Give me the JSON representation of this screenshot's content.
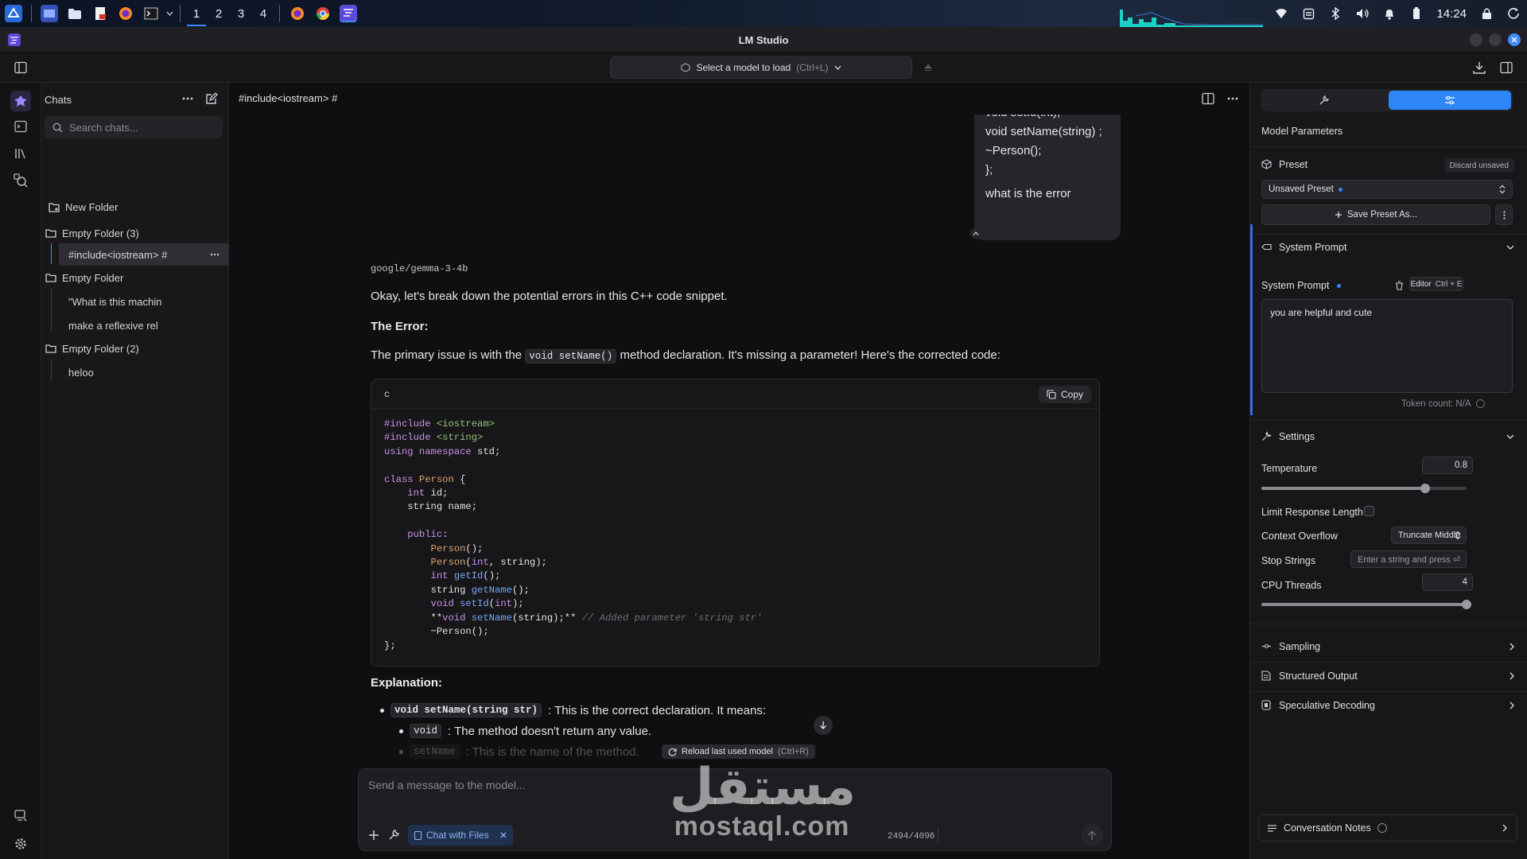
{
  "taskbar": {
    "workspaces": [
      "1",
      "2",
      "3",
      "4"
    ],
    "active_workspace": "1",
    "clock": "14:24",
    "icons": [
      "kde-launcher-icon",
      "desktop-icon",
      "file-manager-icon",
      "pdf-icon",
      "firefox-icon",
      "terminal-icon",
      "firefox-icon",
      "chrome-icon",
      "lmstudio-icon"
    ]
  },
  "window": {
    "title": "LM Studio"
  },
  "toolbar": {
    "model_select_label": "Select a model to load",
    "model_select_shortcut": "(Ctrl+L)"
  },
  "sidebar": {
    "title": "Chats",
    "search_placeholder": "Search chats...",
    "new_folder_label": "New Folder",
    "tree": [
      {
        "type": "folder",
        "label": "Empty Folder (3)"
      },
      {
        "type": "chat",
        "label": "#include<iostream> #",
        "selected": true
      },
      {
        "type": "folder",
        "label": "Empty Folder"
      },
      {
        "type": "chat",
        "label": "\"What is this machin"
      },
      {
        "type": "chat",
        "label": "make a reflexive rel"
      },
      {
        "type": "folder",
        "label": "Empty Folder (2)"
      },
      {
        "type": "chat",
        "label": "heloo"
      }
    ]
  },
  "chat": {
    "title": "#include<iostream> #",
    "user_message_lines": [
      "void setId(int);",
      "void setName(string) ;",
      "~Person();",
      "};",
      "what is the error"
    ],
    "model_name": "google/gemma-3-4b",
    "intro": "Okay, let's break down the potential errors in this C++ code snippet.",
    "error_heading": "The Error:",
    "error_text_before": "The primary issue is with the",
    "error_code": "void setName()",
    "error_text_after": "method declaration. It's missing a parameter!  Here's the corrected code:",
    "code_lang": "c",
    "copy_label": "Copy",
    "explanation_heading": "Explanation:",
    "bullet1_code": "void setName(string str)",
    "bullet1_text": ": This is the correct declaration. It means:",
    "bullet2_code": "void",
    "bullet2_text": ": The method doesn't return any value.",
    "bullet3_code": "setName",
    "bullet3_text": ": This is the name of the method.",
    "reload_label": "Reload last used model",
    "reload_shortcut": "(Ctrl+R)",
    "composer_placeholder": "Send a message to the model...",
    "chat_with_files_label": "Chat with Files",
    "token_count": "2494/4096"
  },
  "watermark": {
    "arabic": "مستقل",
    "latin": "mostaql.com"
  },
  "right_panel": {
    "heading": "Model Parameters",
    "preset_label": "Preset",
    "discard_label": "Discard unsaved",
    "preset_value": "Unsaved Preset",
    "save_preset_label": "Save Preset As...",
    "system_prompt_section": "System Prompt",
    "system_prompt_label": "System Prompt",
    "editor_label": "Editor",
    "editor_shortcut": "Ctrl + E",
    "system_prompt_value": "you are helpful and cute",
    "token_count_label": "Token count: N/A",
    "settings_section": "Settings",
    "temperature_label": "Temperature",
    "temperature_value": "0.8",
    "temperature_fraction": 0.8,
    "limit_response_label": "Limit Response Length",
    "context_overflow_label": "Context Overflow",
    "context_overflow_value": "Truncate Middle",
    "stop_strings_label": "Stop Strings",
    "stop_strings_placeholder": "Enter a string and press ⏎",
    "cpu_threads_label": "CPU Threads",
    "cpu_threads_value": "4",
    "cpu_threads_fraction": 1.0,
    "sampling_label": "Sampling",
    "structured_output_label": "Structured Output",
    "speculative_decoding_label": "Speculative Decoding",
    "conversation_notes_label": "Conversation Notes"
  },
  "colors": {
    "accent": "#2f86f7",
    "background": "#0f0f11",
    "panel": "#17171a"
  }
}
